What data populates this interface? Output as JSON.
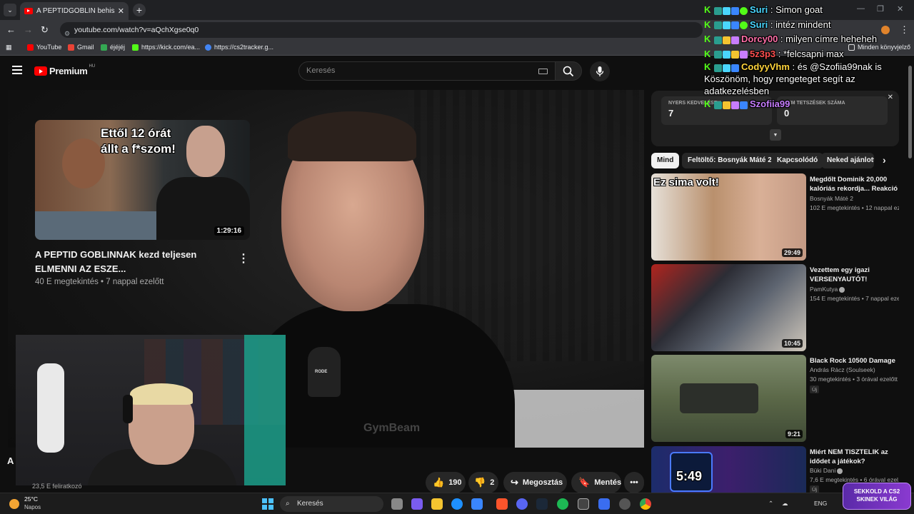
{
  "browser": {
    "tab_title": "A PEPTIDGOBLIN behisztizett R...",
    "url": "youtube.com/watch?v=aQchXgse0q0",
    "bookmarks": [
      {
        "label": "YouTube",
        "color": "#ff0000"
      },
      {
        "label": "Gmail",
        "color": "#ea4335"
      },
      {
        "label": "éjéjéj",
        "color": "#34a853"
      },
      {
        "label": "https://kick.com/ea...",
        "color": "#53fc18"
      },
      {
        "label": "https://cs2tracker.g...",
        "color": "#4285f4"
      }
    ],
    "all_bookmarks": "Minden könyvjelző"
  },
  "youtube": {
    "logo_text": "Premium",
    "logo_region": "HU",
    "search_placeholder": "Keresés"
  },
  "end_screen": {
    "thumb_text": "Ettől 12 órát állt a f*szom!",
    "duration": "1:29:16",
    "title": "A PEPTID GOBLINNAK kezd teljesen ELMENNI AZ ESZE...",
    "meta": "40 E megtekintés • 7 nappal ezelőtt"
  },
  "video_overlay": {
    "mic_brand": "RODE",
    "shirt_brand": "GymBeam"
  },
  "below_video": {
    "channel_initial": "A",
    "subscribers": "23,5 E feliratkozó"
  },
  "actions": {
    "likes": "190",
    "dislikes": "2",
    "share": "Megosztás",
    "save": "Mentés"
  },
  "live_panel": {
    "stat1_label": "NYERS KEDVELÉSEK",
    "stat1_value": "7",
    "stat2_label": "NEM TETSZÉSEK SZÁMA",
    "stat2_value": "0"
  },
  "chips": [
    "Mind",
    "Feltöltő: Bosnyák Máté 2",
    "Kapcsolódó",
    "Neked ajánlott"
  ],
  "recommendations": [
    {
      "thumb_text": "Ez sima volt!",
      "duration": "29:49",
      "title": "Megdőlt Dominik 20,000 kalóriás rekordja... Reakció",
      "channel": "Bosnyák Máté 2",
      "meta": "102 E megtekintés • 12 nappal ez..."
    },
    {
      "thumb_text": "",
      "duration": "10:45",
      "title": "Vezettem egy igazi VERSENYAUTÓT!",
      "channel": "PamKutya",
      "meta": "154 E megtekintés • 7 nappal eze..."
    },
    {
      "thumb_text": "",
      "duration": "9:21",
      "title": "Black Rock 10500 Damage",
      "channel": "András Rácz (Soulseek)",
      "meta": "30 megtekintés • 3 órával ezelőtt",
      "badge": "Új"
    },
    {
      "thumb_text": "5:49",
      "duration": "",
      "title": "Miért NEM TISZTELIK az idődet a játékok?",
      "channel": "Büki Dani",
      "meta": "7,6 E megtekintés • 6 órával ezel...",
      "badge": "Új"
    }
  ],
  "chat": [
    {
      "user": "Suri",
      "color": "#4ad6ff",
      "message": "Simon goat"
    },
    {
      "user": "Suri",
      "color": "#4ad6ff",
      "message": "intéz mindent"
    },
    {
      "user": "Dorcy00",
      "color": "#ff6fa8",
      "message": "milyen címre heheheh"
    },
    {
      "user": "5z3p3",
      "color": "#ff4f4f",
      "message": "*felcsapni max"
    },
    {
      "user": "CodyyVhm",
      "color": "#ffd43b",
      "message": "és @Szofiia99nak is Köszönöm, hogy rengeteget segít az adatkezelésben"
    },
    {
      "user": "Szofiia99",
      "color": "#c77dff",
      "message": ""
    }
  ],
  "taskbar": {
    "temperature": "25°C",
    "weather": "Napos",
    "search": "Keresés",
    "lang": "ENG"
  },
  "stream_badge": "SEKKOLD A CS2 SKINEK VILÁG"
}
